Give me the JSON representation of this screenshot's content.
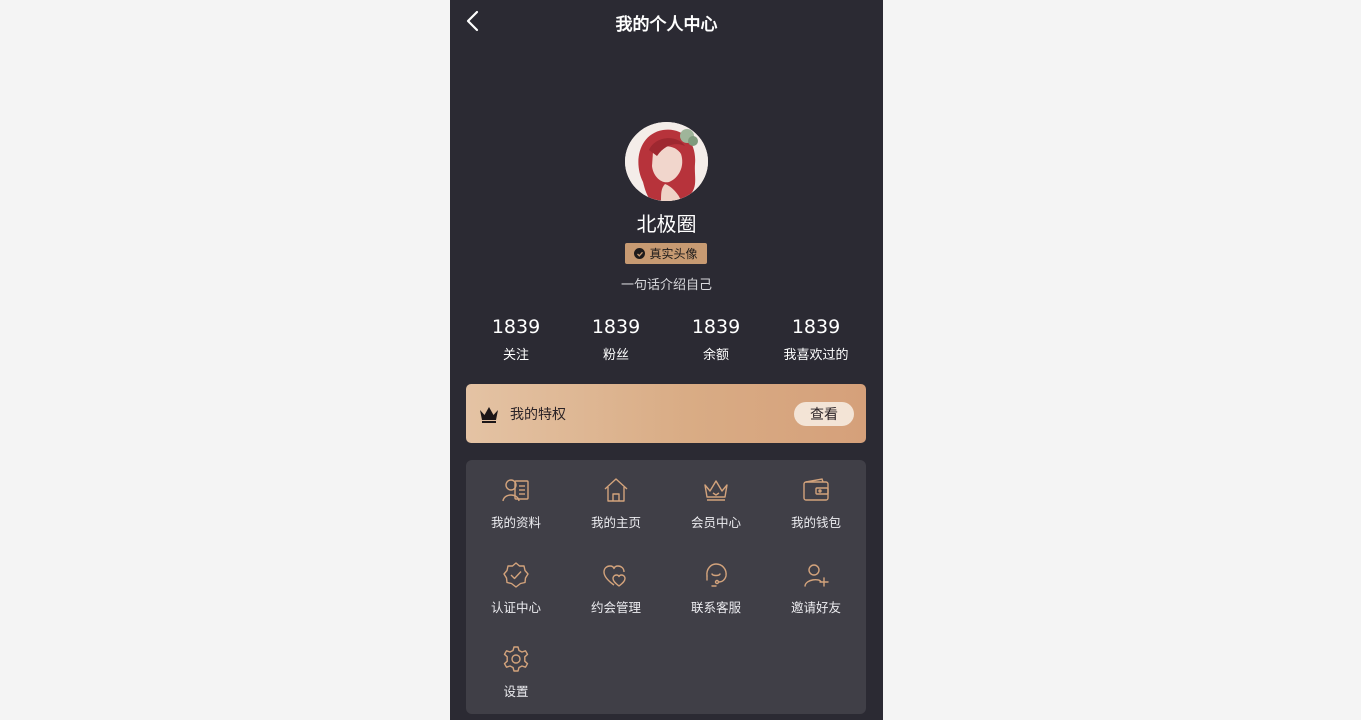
{
  "header": {
    "title": "我的个人中心",
    "back_icon": "chevron-left-icon"
  },
  "profile": {
    "name": "北极圈",
    "badge": "真实头像",
    "intro": "一句话介绍自己"
  },
  "stats": [
    {
      "value": "1839",
      "label": "关注"
    },
    {
      "value": "1839",
      "label": "粉丝"
    },
    {
      "value": "1839",
      "label": "余额"
    },
    {
      "value": "1839",
      "label": "我喜欢过的"
    }
  ],
  "privilege": {
    "label": "我的特权",
    "button": "查看",
    "icon": "crown-icon"
  },
  "menu": [
    {
      "label": "我的资料",
      "icon": "profile-card-icon"
    },
    {
      "label": "我的主页",
      "icon": "home-icon"
    },
    {
      "label": "会员中心",
      "icon": "crown-icon"
    },
    {
      "label": "我的钱包",
      "icon": "wallet-icon"
    },
    {
      "label": "认证中心",
      "icon": "verified-badge-icon"
    },
    {
      "label": "约会管理",
      "icon": "hearts-icon"
    },
    {
      "label": "联系客服",
      "icon": "headset-icon"
    },
    {
      "label": "邀请好友",
      "icon": "add-user-icon"
    },
    {
      "label": "设置",
      "icon": "gear-icon"
    }
  ],
  "colors": {
    "page_bg": "#f4f4f4",
    "phone_bg": "#2b2a33",
    "menu_bg": "#403f47",
    "accent_gold": "#d9ac85",
    "icon_stroke": "#d3a37c"
  }
}
